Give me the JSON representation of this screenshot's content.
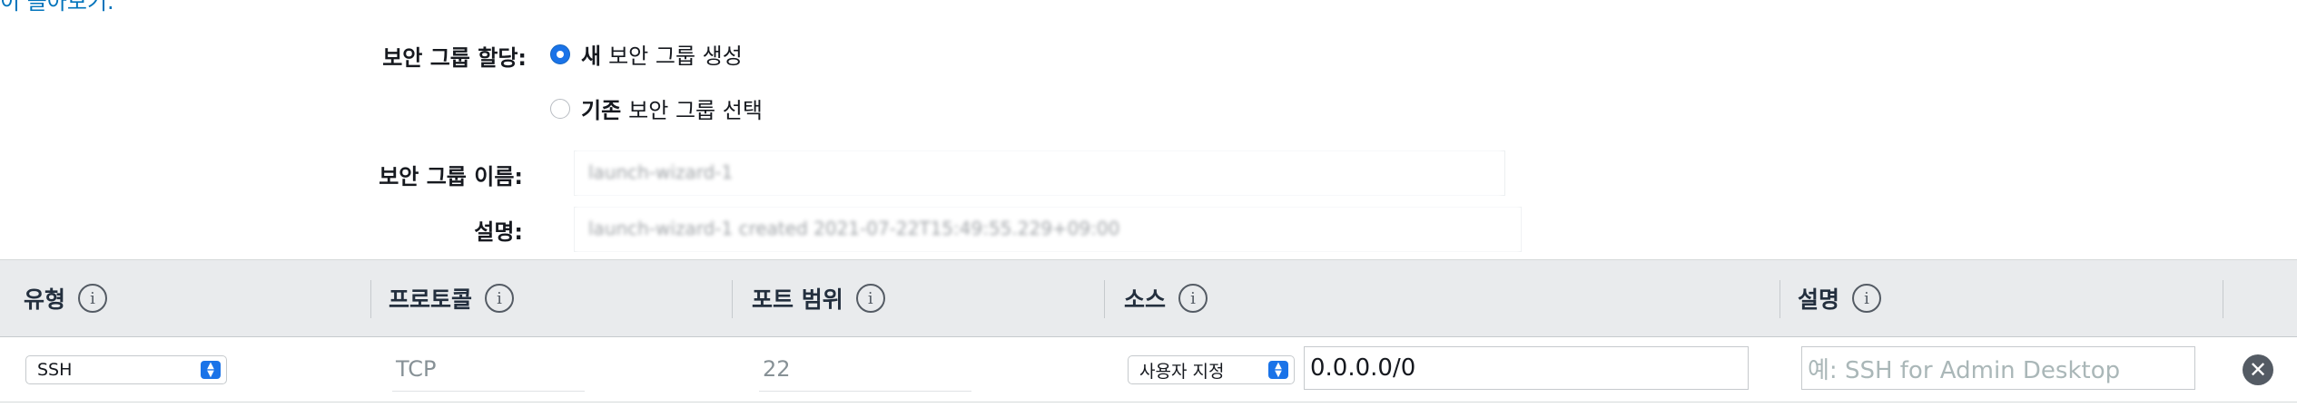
{
  "top_link": "이 돌아보기.",
  "security_group": {
    "assign_label": "보안 그룹 할당:",
    "option_new_bold": "새",
    "option_new_rest": "보안 그룹 생성",
    "option_new_selected": true,
    "option_existing_bold": "기존",
    "option_existing_rest": "보안 그룹 선택",
    "option_existing_selected": false,
    "name_label": "보안 그룹 이름:",
    "name_value": "launch-wizard-1",
    "description_label": "설명:",
    "description_value": "launch-wizard-1 created 2021-07-22T15:49:55.229+09:00"
  },
  "table": {
    "headers": [
      "유형",
      "프로토콜",
      "포트 범위",
      "소스",
      "설명"
    ],
    "info_icon_glyph": "i",
    "rows": [
      {
        "type": "SSH",
        "protocol": "TCP",
        "port_range": "22",
        "source_mode": "사용자 지정",
        "source_cidr": "0.0.0.0/0",
        "description_placeholder": "예: SSH for Admin Desktop",
        "remove_glyph": "✕"
      }
    ]
  },
  "colors": {
    "accent": "#1a73e8",
    "link": "#0073bb",
    "header_bg": "#e9ebed"
  }
}
